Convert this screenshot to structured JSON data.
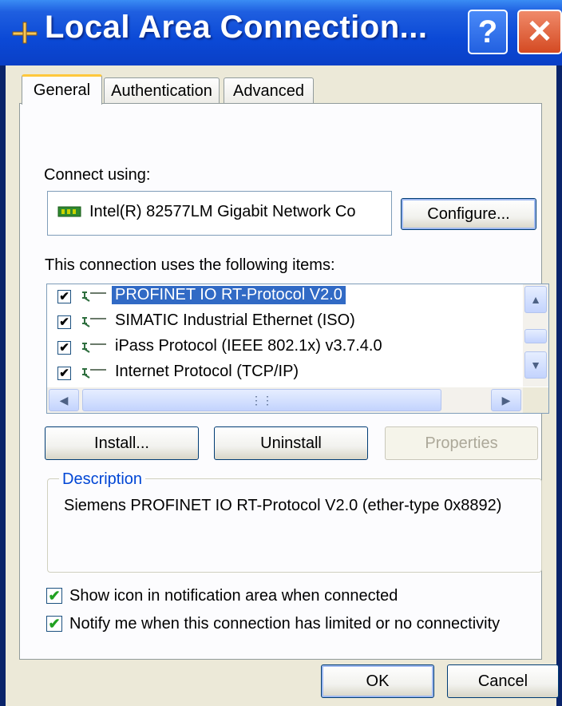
{
  "window": {
    "title": "Local Area Connection...",
    "help_label": "?",
    "close_label": "✕"
  },
  "tabs": [
    {
      "label": "General",
      "active": true
    },
    {
      "label": "Authentication",
      "active": false
    },
    {
      "label": "Advanced",
      "active": false
    }
  ],
  "general": {
    "connect_using_label": "Connect using:",
    "adapter_name": "Intel(R) 82577LM Gigabit Network Co",
    "configure_label": "Configure...",
    "items_label": "This connection uses the following items:",
    "items": [
      {
        "label": "PROFINET IO RT-Protocol V2.0",
        "checked": true,
        "selected": true
      },
      {
        "label": "SIMATIC Industrial Ethernet (ISO)",
        "checked": true,
        "selected": false
      },
      {
        "label": "iPass Protocol (IEEE 802.1x) v3.7.4.0",
        "checked": true,
        "selected": false
      },
      {
        "label": "Internet Protocol (TCP/IP)",
        "checked": true,
        "selected": false
      }
    ],
    "check_mark": "✔",
    "install_label": "Install...",
    "uninstall_label": "Uninstall",
    "properties_label": "Properties",
    "description_title": "Description",
    "description_text": "Siemens PROFINET IO RT-Protocol V2.0 (ether-type 0x8892)",
    "show_icon_label": "Show icon in notification area when connected",
    "show_icon_checked": true,
    "notify_label": "Notify me when this connection has limited or no connectivity",
    "notify_checked": true
  },
  "footer": {
    "ok_label": "OK",
    "cancel_label": "Cancel"
  },
  "colors": {
    "titlebar": "#0b49d6",
    "selection": "#316ac5",
    "group_title": "#0046d5",
    "dialog_bg": "#ece9d8",
    "check_green": "#21a121"
  }
}
